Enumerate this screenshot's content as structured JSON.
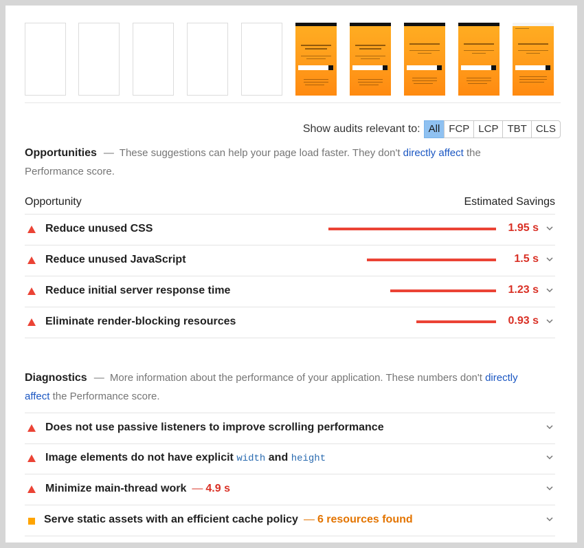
{
  "filmstrip": {
    "frames": [
      {
        "filled": false
      },
      {
        "filled": false
      },
      {
        "filled": false
      },
      {
        "filled": false
      },
      {
        "filled": false
      },
      {
        "filled": true,
        "variant": "a"
      },
      {
        "filled": true,
        "variant": "a"
      },
      {
        "filled": true,
        "variant": "b"
      },
      {
        "filled": true,
        "variant": "b"
      },
      {
        "filled": true,
        "variant": "c"
      }
    ]
  },
  "filters": {
    "label": "Show audits relevant to:",
    "buttons": [
      {
        "label": "All",
        "active": true
      },
      {
        "label": "FCP",
        "active": false
      },
      {
        "label": "LCP",
        "active": false
      },
      {
        "label": "TBT",
        "active": false
      },
      {
        "label": "CLS",
        "active": false
      }
    ]
  },
  "opportunities": {
    "title": "Opportunities",
    "dash": "—",
    "desc_before": "These suggestions can help your page load faster. They don't",
    "link": "directly affect",
    "desc_after": "the Performance score.",
    "col_left": "Opportunity",
    "col_right": "Estimated Savings",
    "items": [
      {
        "label": "Reduce unused CSS",
        "savings": "1.95 s",
        "seconds": 1.95
      },
      {
        "label": "Reduce unused JavaScript",
        "savings": "1.5 s",
        "seconds": 1.5
      },
      {
        "label": "Reduce initial server response time",
        "savings": "1.23 s",
        "seconds": 1.23
      },
      {
        "label": "Eliminate render-blocking resources",
        "savings": "0.93 s",
        "seconds": 0.93
      }
    ]
  },
  "diagnostics": {
    "title": "Diagnostics",
    "dash": "—",
    "desc_before": "More information about the performance of your application. These numbers don't",
    "link": "directly affect",
    "desc_after": "the Performance score.",
    "items": [
      {
        "label": "Does not use passive listeners to improve scrolling performance"
      },
      {
        "label_a": "Image elements do not have explicit",
        "code_a": "width",
        "label_b": "and",
        "code_b": "height"
      },
      {
        "label": "Minimize main-thread work",
        "dash": "—",
        "extra": "4.9 s"
      },
      {
        "label": "Serve static assets with an efficient cache policy",
        "dash": "—",
        "extra": "6 resources found"
      }
    ]
  },
  "colors": {
    "fail": "#eb4335",
    "average": "#ffa400",
    "link": "#1a56c2",
    "filter_active": "#8fc1f1",
    "thumb_orange": "#ff9a1a"
  }
}
